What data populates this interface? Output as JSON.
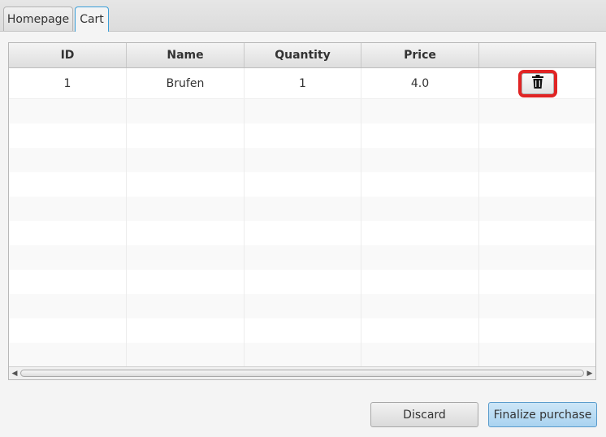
{
  "tabs": [
    {
      "label": "Homepage",
      "selected": false
    },
    {
      "label": "Cart",
      "selected": true
    }
  ],
  "table": {
    "columns": [
      "ID",
      "Name",
      "Quantity",
      "Price",
      ""
    ],
    "rows": [
      {
        "id": "1",
        "name": "Brufen",
        "quantity": "1",
        "price": "4.0",
        "action_icon": "trash-icon"
      }
    ]
  },
  "buttons": {
    "discard": "Discard",
    "finalize": "Finalize purchase"
  },
  "colors": {
    "highlight": "#e02424",
    "tab_accent": "#3a9fd9",
    "primary_button": "#a9d3f0"
  }
}
